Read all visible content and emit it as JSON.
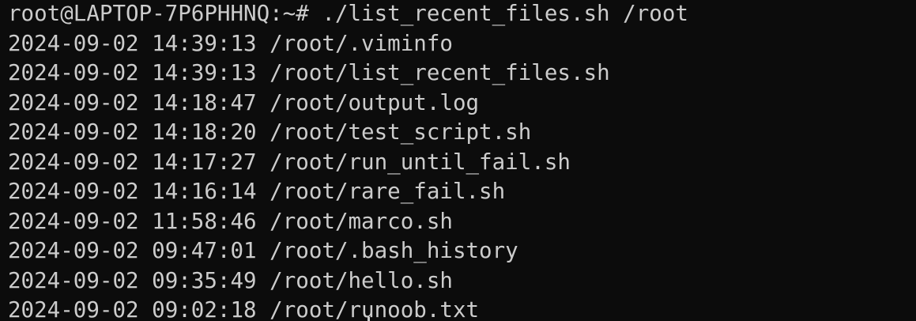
{
  "colors": {
    "background": "#0c0c0c",
    "foreground": "#cccccc"
  },
  "prompt": {
    "user_host": "root@LAPTOP-7P6PHHNQ:~#",
    "command": "./list_recent_files.sh /root"
  },
  "entries": [
    {
      "date": "2024-09-02",
      "time": "14:39:13",
      "path": "/root/.viminfo"
    },
    {
      "date": "2024-09-02",
      "time": "14:39:13",
      "path": "/root/list_recent_files.sh"
    },
    {
      "date": "2024-09-02",
      "time": "14:18:47",
      "path": "/root/output.log"
    },
    {
      "date": "2024-09-02",
      "time": "14:18:20",
      "path": "/root/test_script.sh"
    },
    {
      "date": "2024-09-02",
      "time": "14:17:27",
      "path": "/root/run_until_fail.sh"
    },
    {
      "date": "2024-09-02",
      "time": "14:16:14",
      "path": "/root/rare_fail.sh"
    },
    {
      "date": "2024-09-02",
      "time": "11:58:46",
      "path": "/root/marco.sh"
    },
    {
      "date": "2024-09-02",
      "time": "09:47:01",
      "path": "/root/.bash_history"
    },
    {
      "date": "2024-09-02",
      "time": "09:35:49",
      "path": "/root/hello.sh"
    },
    {
      "date": "2024-09-02",
      "time": "09:02:18",
      "path": "/root/runoob.txt"
    }
  ]
}
